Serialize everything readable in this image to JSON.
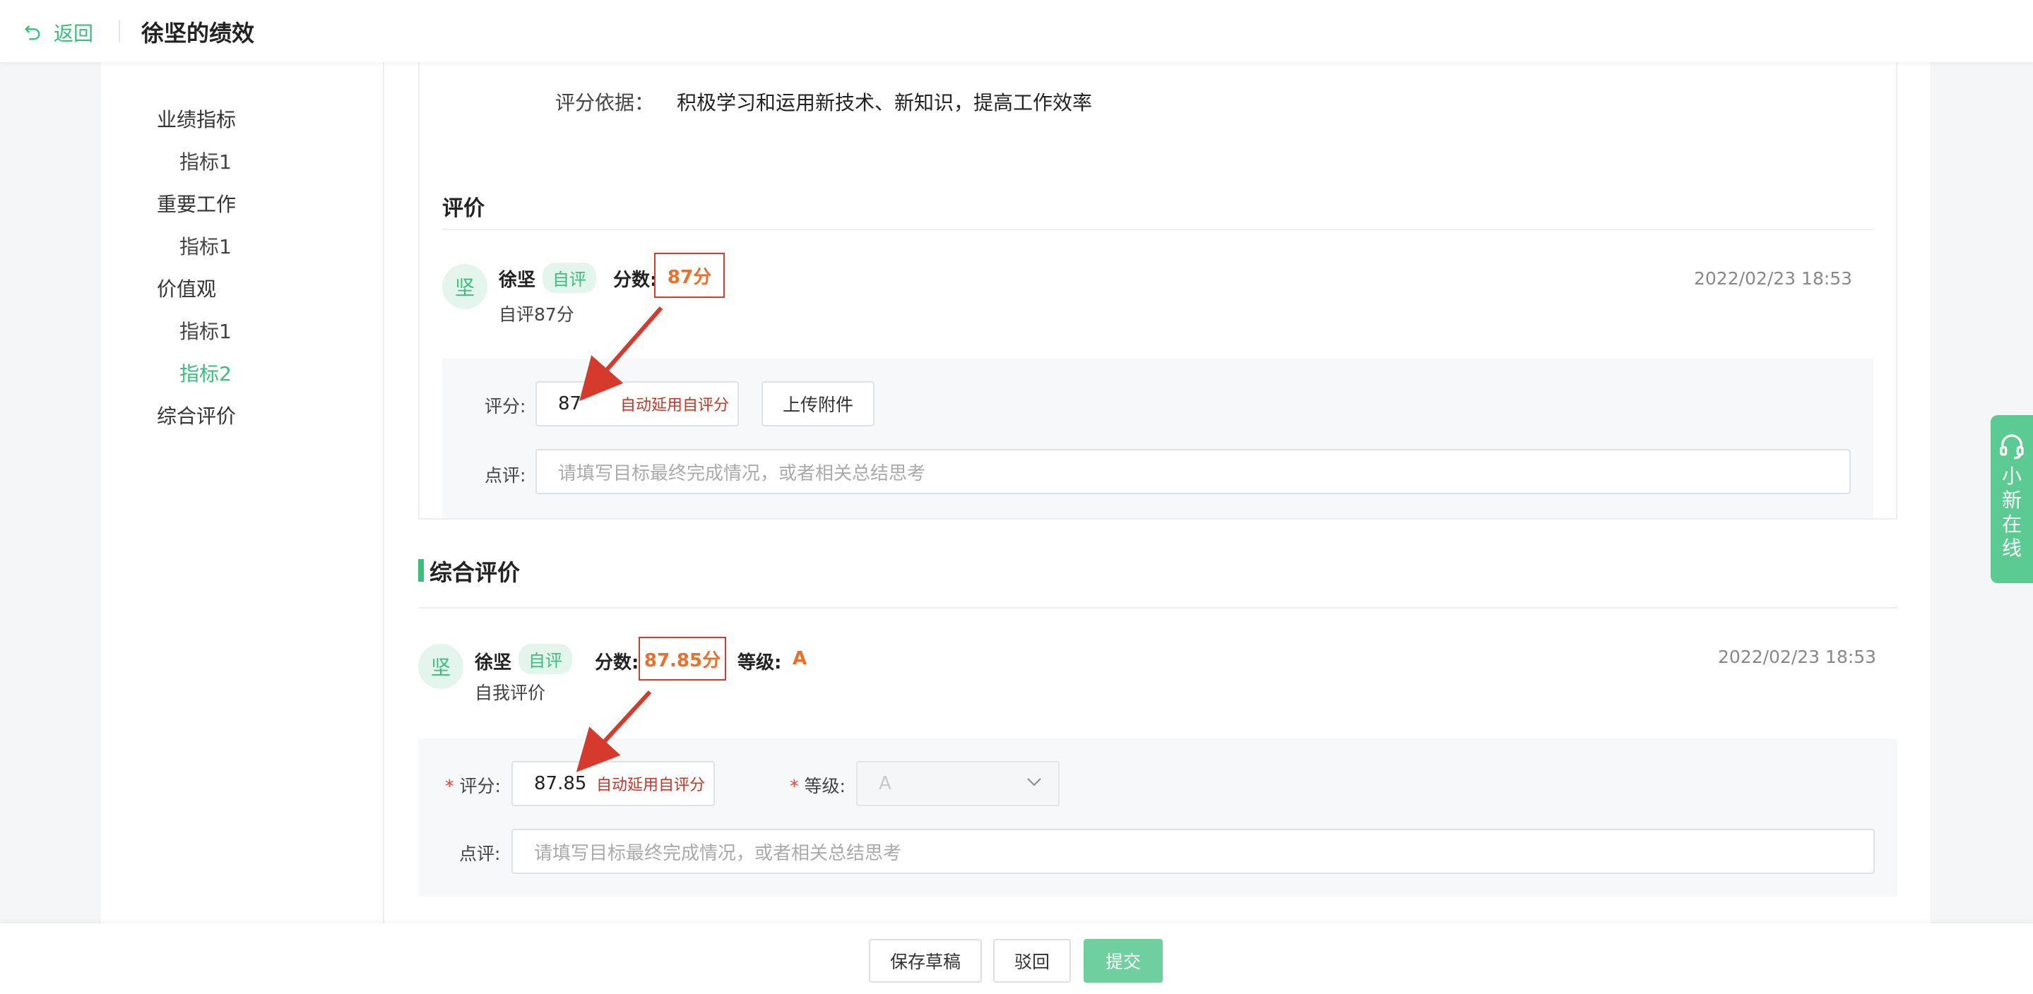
{
  "header": {
    "back_label": "返回",
    "title": "徐坚的绩效"
  },
  "nav": {
    "items": [
      {
        "label": "业绩指标",
        "level": 1,
        "active": false
      },
      {
        "label": "指标1",
        "level": 2,
        "active": false
      },
      {
        "label": "重要工作",
        "level": 1,
        "active": false
      },
      {
        "label": "指标1",
        "level": 2,
        "active": false
      },
      {
        "label": "价值观",
        "level": 1,
        "active": false
      },
      {
        "label": "指标1",
        "level": 2,
        "active": false
      },
      {
        "label": "指标2",
        "level": 2,
        "active": true
      },
      {
        "label": "综合评价",
        "level": 1,
        "active": false
      }
    ]
  },
  "criteria": {
    "label": "评分依据：",
    "text": "积极学习和运用新技术、新知识，提高工作效率"
  },
  "evaluation": {
    "title": "评价",
    "avatar": "坚",
    "name": "徐坚",
    "tag": "自评",
    "score_label": "分数:",
    "score": "87分",
    "comment": "自评87分",
    "time": "2022/02/23 18:53",
    "form": {
      "score_label": "评分:",
      "score_value": "87",
      "auto_hint": "自动延用自评分",
      "upload_label": "上传附件",
      "comment_label": "点评:",
      "comment_placeholder": "请填写目标最终完成情况，或者相关总结思考"
    }
  },
  "summary": {
    "title": "综合评价",
    "avatar": "坚",
    "name": "徐坚",
    "tag": "自评",
    "score_label": "分数:",
    "score": "87.85分",
    "grade_label": "等级:",
    "grade": "A",
    "comment": "自我评价",
    "time": "2022/02/23 18:53",
    "form": {
      "required_mark": "*",
      "score_label": "评分:",
      "score_value": "87.85",
      "auto_hint": "自动延用自评分",
      "grade_label": "等级:",
      "grade_value": "A",
      "comment_label": "点评:",
      "comment_placeholder": "请填写目标最终完成情况，或者相关总结思考"
    }
  },
  "footer": {
    "save_draft": "保存草稿",
    "reject": "驳回",
    "submit": "提交"
  },
  "service": {
    "label": "小新在线"
  },
  "colors": {
    "accent": "#3dbd7d",
    "score": "#e8702a",
    "annotation": "#d53a2c"
  }
}
